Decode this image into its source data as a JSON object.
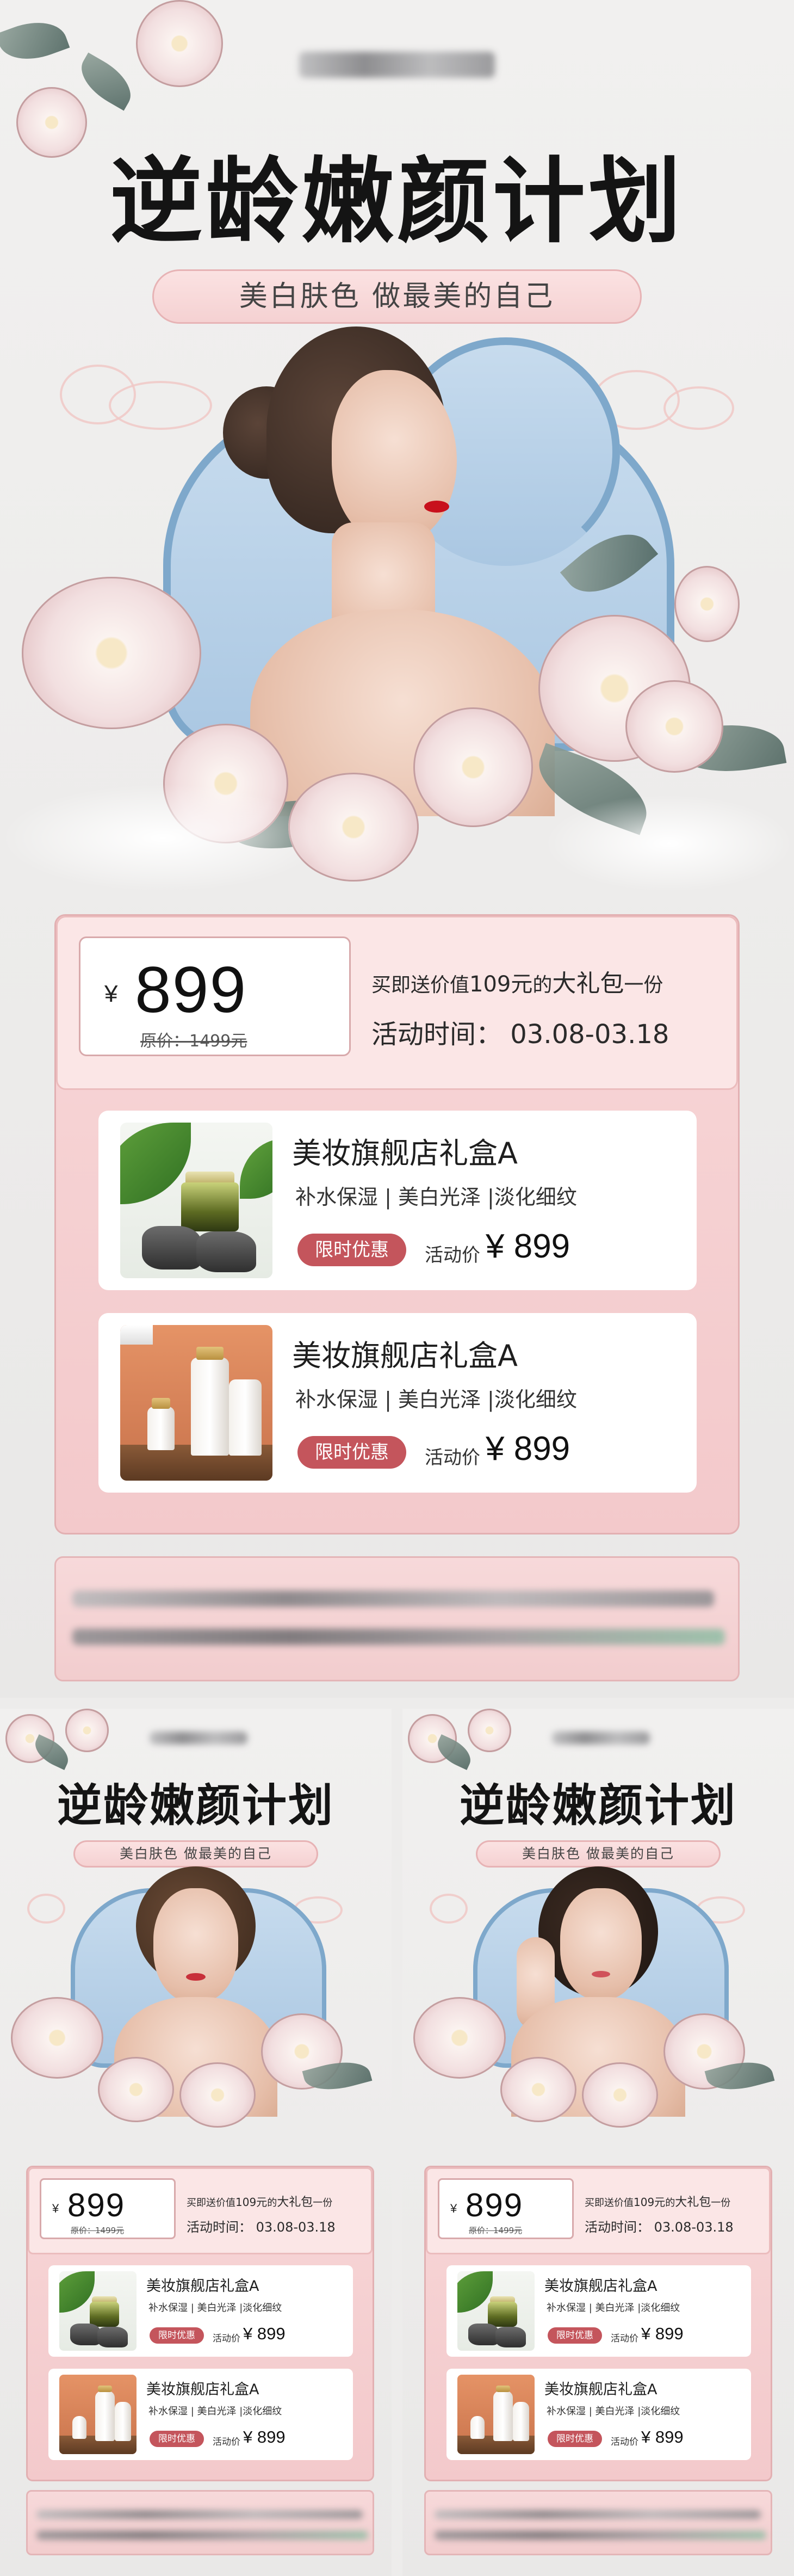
{
  "posters": [
    {
      "id": "main",
      "title": "逆龄嫩颜计划",
      "subtitle": "美白肤色 做最美的自己",
      "price_currency": "¥",
      "price": "899",
      "original_price": "原价：1499元",
      "gift_prefix": "买即送价值",
      "gift_amount": "109元",
      "gift_mid": "的",
      "gift_big": "大礼包",
      "gift_suffix": "一份",
      "activity_time": "活动时间：  03.08-03.18",
      "products": [
        {
          "name": "美妆旗舰店礼盒A",
          "tags": "补水保湿 | 美白光泽 |淡化细纹",
          "badge": "限时优惠",
          "activity_label": "活动价",
          "activity_price": "¥ 899",
          "thumb": "green-jar"
        },
        {
          "name": "美妆旗舰店礼盒A",
          "tags": "补水保湿 | 美白光泽 |淡化细纹",
          "badge": "限时优惠",
          "activity_label": "活动价",
          "activity_price": "¥ 899",
          "thumb": "cream-tubes"
        }
      ]
    },
    {
      "id": "left-small",
      "title": "逆龄嫩颜计划",
      "subtitle": "美白肤色 做最美的自己",
      "price_currency": "¥",
      "price": "899",
      "original_price": "原价：1499元",
      "gift_prefix": "买即送价值",
      "gift_amount": "109元",
      "gift_mid": "的",
      "gift_big": "大礼包",
      "gift_suffix": "一份",
      "activity_time": "活动时间：  03.08-03.18",
      "products": [
        {
          "name": "美妆旗舰店礼盒A",
          "tags": "补水保湿 | 美白光泽 |淡化细纹",
          "badge": "限时优惠",
          "activity_label": "活动价",
          "activity_price": "¥ 899",
          "thumb": "green-jar"
        },
        {
          "name": "美妆旗舰店礼盒A",
          "tags": "补水保湿 | 美白光泽 |淡化细纹",
          "badge": "限时优惠",
          "activity_label": "活动价",
          "activity_price": "¥ 899",
          "thumb": "cream-tubes"
        }
      ]
    },
    {
      "id": "right-small",
      "title": "逆龄嫩颜计划",
      "subtitle": "美白肤色 做最美的自己",
      "price_currency": "¥",
      "price": "899",
      "original_price": "原价：1499元",
      "gift_prefix": "买即送价值",
      "gift_amount": "109元",
      "gift_mid": "的",
      "gift_big": "大礼包",
      "gift_suffix": "一份",
      "activity_time": "活动时间：  03.08-03.18",
      "products": [
        {
          "name": "美妆旗舰店礼盒A",
          "tags": "补水保湿 | 美白光泽 |淡化细纹",
          "badge": "限时优惠",
          "activity_label": "活动价",
          "activity_price": "¥ 899",
          "thumb": "green-jar"
        },
        {
          "name": "美妆旗舰店礼盒A",
          "tags": "补水保湿 | 美白光泽 |淡化细纹",
          "badge": "限时优惠",
          "activity_label": "活动价",
          "activity_price": "¥ 899",
          "thumb": "cream-tubes"
        }
      ]
    }
  ],
  "colors": {
    "accent_pink": "#f4cdce",
    "badge_red": "#c4555c",
    "frame_blue": "#7ea8cb",
    "title_black": "#141414"
  }
}
